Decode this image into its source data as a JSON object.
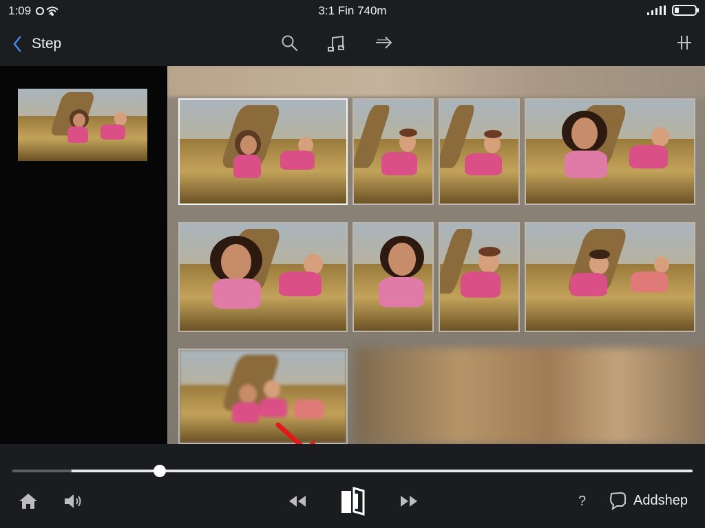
{
  "status_bar": {
    "time": "1:09",
    "center_text": "3:1 Fin 740m",
    "signal_icon": "signal-bars-icon",
    "battery_icon": "battery-icon",
    "wifi_icon": "wifi-icon"
  },
  "nav": {
    "back_icon": "chevron-left-icon",
    "title": "Step",
    "search_icon": "search-icon",
    "music_icon": "music-note-icon",
    "forward_icon": "arrow-right-icon",
    "grid_icon": "crosshair-grid-icon"
  },
  "sidebar": {
    "thumbnail_icon": "photo-thumbnail"
  },
  "grid": {
    "tiles": [
      {
        "name": "photo-1",
        "selected": true
      },
      {
        "name": "photo-2",
        "selected": false
      },
      {
        "name": "photo-3",
        "selected": false
      },
      {
        "name": "photo-4",
        "selected": false
      },
      {
        "name": "photo-5",
        "selected": false
      },
      {
        "name": "photo-6",
        "selected": false
      },
      {
        "name": "photo-7",
        "selected": false
      },
      {
        "name": "photo-8",
        "selected": false
      },
      {
        "name": "photo-9",
        "selected": false
      }
    ]
  },
  "player": {
    "progress_fraction": 0.217,
    "buffer_fraction": 0.087,
    "home_icon": "home-icon",
    "volume_icon": "speaker-icon",
    "rewind_icon": "rewind-icon",
    "center_icon": "split-view-icon",
    "fast_forward_icon": "fast-forward-icon",
    "help_label": "?",
    "add_icon": "chat-bubble-icon",
    "add_label": "Addshep"
  },
  "colors": {
    "accent_blue": "#3b8cf0",
    "annotation_red": "#e01a1a",
    "background": "#1c1d20"
  }
}
